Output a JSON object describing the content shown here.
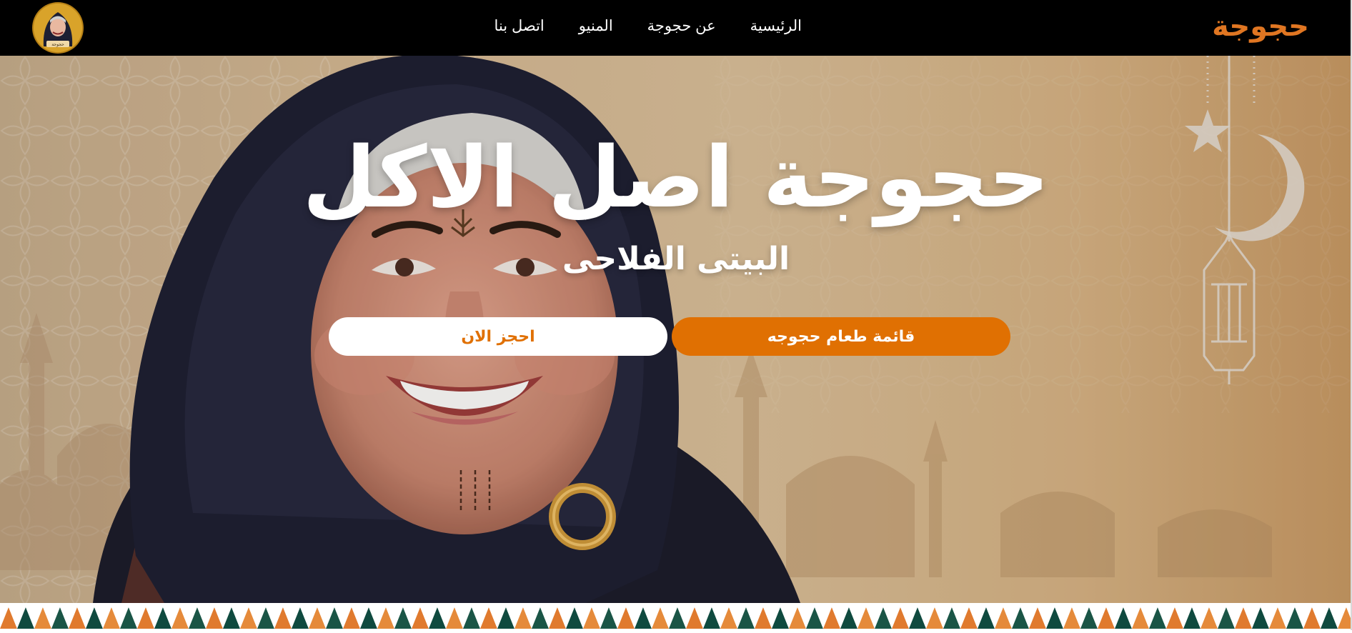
{
  "navbar": {
    "brand": "حجوجة",
    "links": [
      "الرئيسية",
      "عن حجوجة",
      "المنيو",
      "اتصل بنا"
    ],
    "avatar_caption": "حجوجة"
  },
  "hero": {
    "title": "حجوجة اصل الاكل",
    "subtitle": "البيتى الفلاحى",
    "menu_button": "قائمة طعام حجوجه",
    "book_button": "احجز الان"
  },
  "colors": {
    "brand": "#e07622",
    "accent": "#e07002",
    "navbar_bg": "#000000",
    "pattern": [
      "#e07a2e",
      "#0f4a3f",
      "#e58a3a",
      "#1a5546"
    ]
  },
  "icons": {
    "crescent": "crescent-moon-icon",
    "star": "star-icon",
    "lantern": "lantern-icon"
  }
}
